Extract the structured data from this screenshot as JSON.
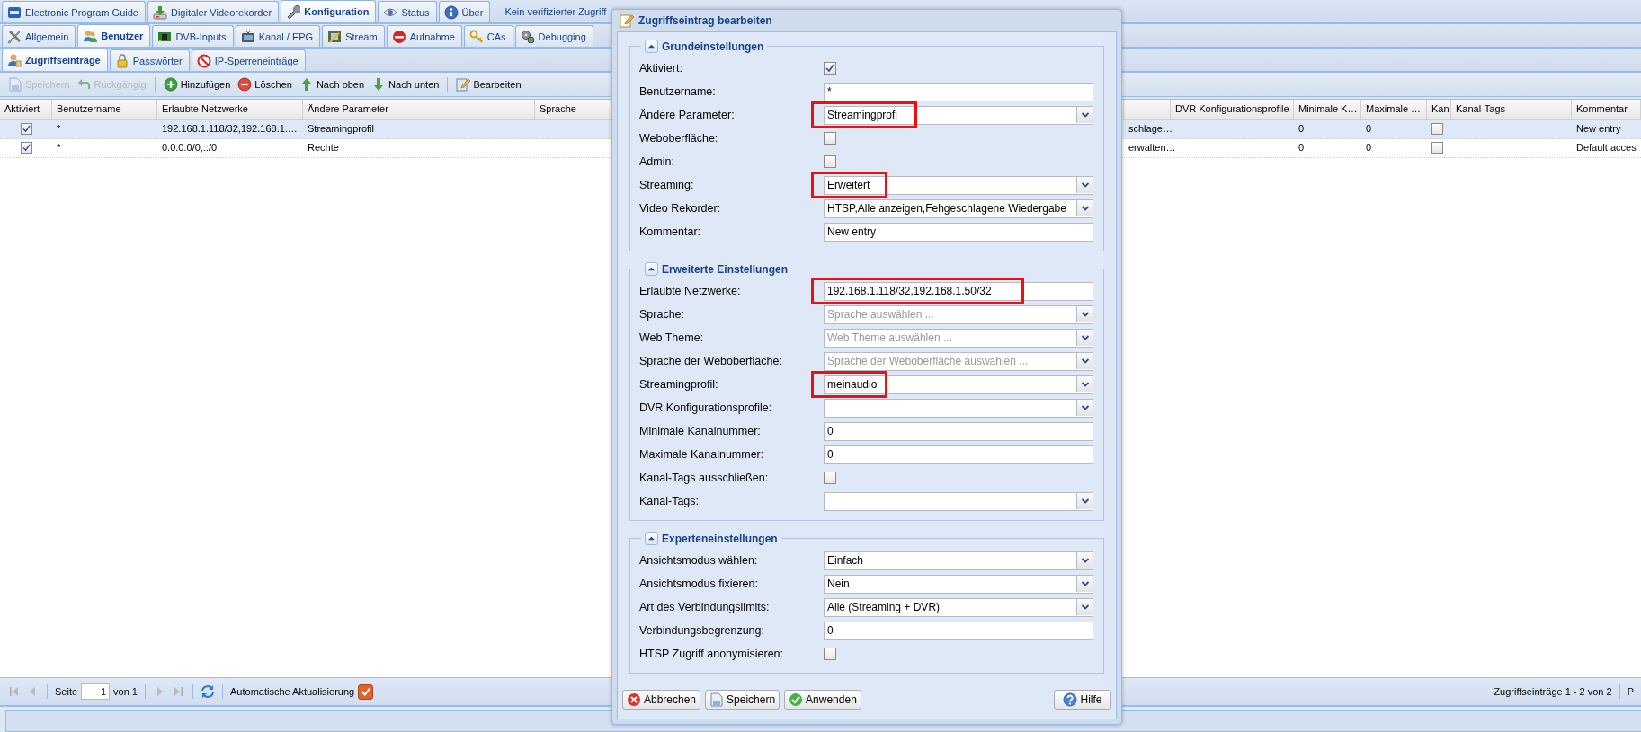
{
  "main_tabs": [
    {
      "label": "Electronic Program Guide",
      "selected": false
    },
    {
      "label": "Digitaler Videorekorder",
      "selected": false
    },
    {
      "label": "Konfiguration",
      "selected": true
    },
    {
      "label": "Status",
      "selected": false
    },
    {
      "label": "Über",
      "selected": false
    }
  ],
  "header_status": [
    "Kein verifizierter Zugriff"
  ],
  "sub_tabs": [
    {
      "label": "Allgemein",
      "selected": false
    },
    {
      "label": "Benutzer",
      "selected": true
    },
    {
      "label": "DVB-Inputs",
      "selected": false
    },
    {
      "label": "Kanal / EPG",
      "selected": false
    },
    {
      "label": "Stream",
      "selected": false
    },
    {
      "label": "Aufnahme",
      "selected": false
    },
    {
      "label": "CAs",
      "selected": false
    },
    {
      "label": "Debugging",
      "selected": false
    }
  ],
  "section_tabs": [
    {
      "label": "Zugriffseinträge",
      "selected": true
    },
    {
      "label": "Passwörter",
      "selected": false
    },
    {
      "label": "IP-Sperreneinträge",
      "selected": false
    }
  ],
  "toolbar": [
    {
      "label": "Speichern",
      "disabled": true
    },
    {
      "label": "Rückgängig",
      "disabled": true
    },
    {
      "label": "Hinzufügen",
      "disabled": false
    },
    {
      "label": "Löschen",
      "disabled": false
    },
    {
      "label": "Nach oben",
      "disabled": false
    },
    {
      "label": "Nach unten",
      "disabled": false
    },
    {
      "label": "Bearbeiten",
      "disabled": false
    }
  ],
  "table": {
    "columns": [
      {
        "label": "Aktiviert"
      },
      {
        "label": "Benutzername"
      },
      {
        "label": "Erlaubte Netzwerke"
      },
      {
        "label": "Ändere Parameter"
      },
      {
        "label": "Sprache"
      },
      {},
      {
        "label": "DVR Konfigurationsprofile"
      },
      {
        "label": "Minimale K…"
      },
      {
        "label": "Maximale …"
      },
      {
        "label": "Kan"
      },
      {
        "label": "Kanal-Tags"
      },
      {
        "label": "Kommentar"
      }
    ],
    "rows": [
      {
        "selected": true,
        "enabled": true,
        "username": "*",
        "networks": "192.168.1.118/32,192.168.1.…",
        "parameters": "Streamingprofil",
        "column_6": "schlage…",
        "min_channel": "0",
        "max_channel": "0",
        "exclude_tags": false,
        "comment": "New entry"
      },
      {
        "selected": false,
        "enabled": true,
        "username": "*",
        "networks": "0.0.0.0/0,::/0",
        "parameters": "Rechte",
        "column_6": "erwalten…",
        "min_channel": "0",
        "max_channel": "0",
        "exclude_tags": false,
        "comment": "Default acces"
      }
    ]
  },
  "paging": {
    "page_label": "Seite",
    "page": "1",
    "page_count": "von 1",
    "auto_refresh_label": "Automatische Aktualisierung",
    "auto_refresh": true,
    "summary": "Zugriffseinträge 1 - 2 von 2",
    "cut_text": "P"
  },
  "dialog": {
    "title": "Zugriffseintrag bearbeiten",
    "sections": [
      {
        "title": "Grundeinstellungen",
        "expanded": true,
        "fields": [
          {
            "label": "Aktiviert:",
            "kind": "checkbox",
            "checked": true
          },
          {
            "label": "Benutzername:",
            "kind": "text",
            "value": "*",
            "highlighted": false
          },
          {
            "label": "Ändere Parameter:",
            "kind": "combo",
            "value": "Streamingprofi",
            "highlighted": true
          },
          {
            "label": "Weboberfläche:",
            "kind": "checkbox",
            "checked": false
          },
          {
            "label": "Admin:",
            "kind": "checkbox",
            "checked": false
          },
          {
            "label": "Streaming:",
            "kind": "combo",
            "value": "Erweitert",
            "highlighted": true
          },
          {
            "label": "Video Rekorder:",
            "kind": "combo",
            "value": "HTSP,Alle anzeigen,Fehgeschlagene Wiedergabe",
            "highlighted": false
          },
          {
            "label": "Kommentar:",
            "kind": "text",
            "value": "New entry",
            "highlighted": false
          }
        ]
      },
      {
        "title": "Erweiterte Einstellungen",
        "expanded": true,
        "fields": [
          {
            "label": "Erlaubte Netzwerke:",
            "kind": "text",
            "value": "192.168.1.118/32,192.168.1.50/32",
            "highlighted": true
          },
          {
            "label": "Sprache:",
            "kind": "combo",
            "placeholder": "Sprache auswählen ..."
          },
          {
            "label": "Web Theme:",
            "kind": "combo",
            "placeholder": "Web Theme auswählen ..."
          },
          {
            "label": "Sprache der Weboberfläche:",
            "kind": "combo",
            "placeholder": "Sprache der Weboberfläche auswählen ..."
          },
          {
            "label": "Streamingprofil:",
            "kind": "combo",
            "value": "meinaudio",
            "highlighted": true
          },
          {
            "label": "DVR Konfigurationsprofile:",
            "kind": "combo"
          },
          {
            "label": "Minimale Kanalnummer:",
            "kind": "text",
            "value": "0",
            "highlighted": false
          },
          {
            "label": "Maximale Kanalnummer:",
            "kind": "text",
            "value": "0",
            "highlighted": false
          },
          {
            "label": "Kanal-Tags ausschließen:",
            "kind": "checkbox",
            "checked": false
          },
          {
            "label": "Kanal-Tags:",
            "kind": "combo"
          }
        ]
      },
      {
        "title": "Experteneinstellungen",
        "expanded": true,
        "fields": [
          {
            "label": "Ansichtsmodus wählen:",
            "kind": "combo",
            "value": "Einfach",
            "highlighted": false
          },
          {
            "label": "Ansichtsmodus fixieren:",
            "kind": "combo",
            "value": "Nein",
            "highlighted": false
          },
          {
            "label": "Art des Verbindungslimits:",
            "kind": "combo",
            "value": "Alle (Streaming + DVR)",
            "highlighted": false
          },
          {
            "label": "Verbindungsbegrenzung:",
            "kind": "text",
            "value": "0",
            "highlighted": false
          },
          {
            "label": "HTSP Zugriff anonymisieren:",
            "kind": "checkbox",
            "checked": false
          }
        ]
      }
    ],
    "buttons": [
      "Abbrechen",
      "Speichern",
      "Anwenden"
    ],
    "help_button": "Hilfe"
  }
}
